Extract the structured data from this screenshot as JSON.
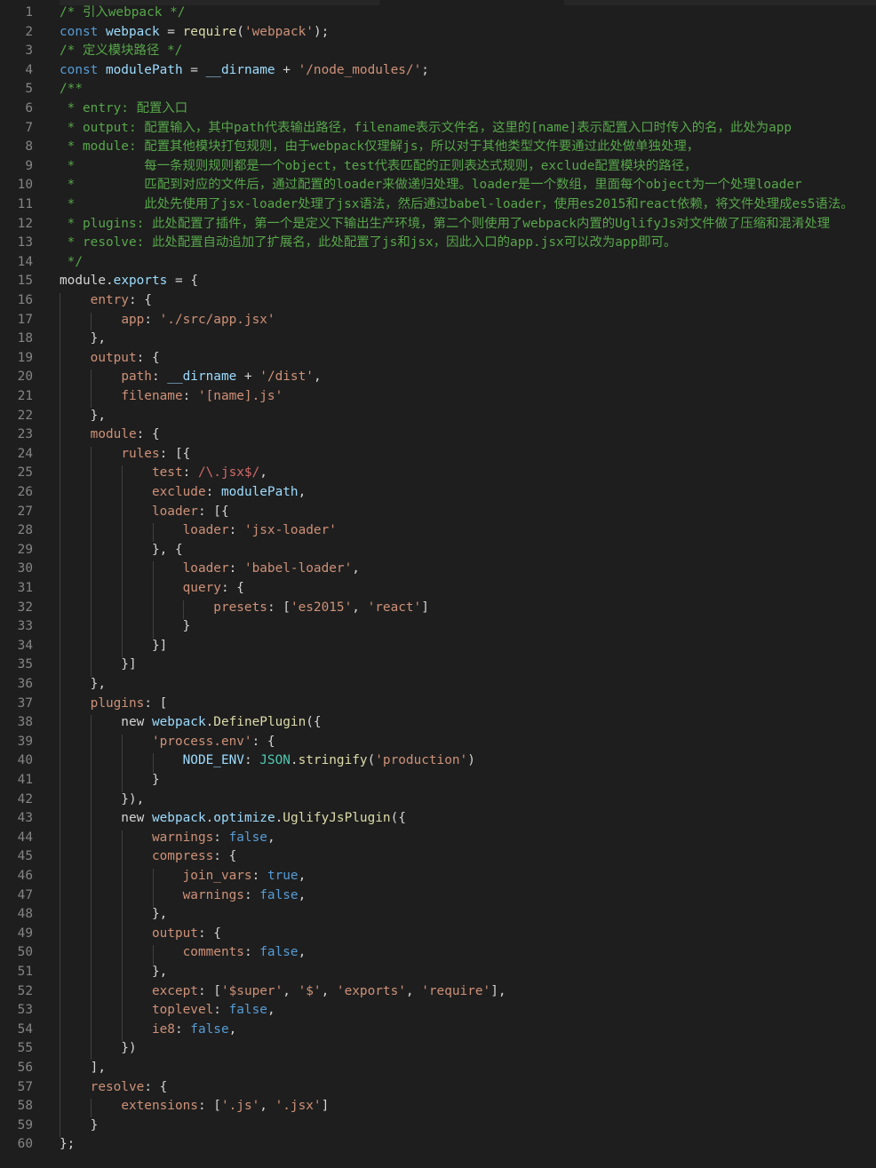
{
  "editor": {
    "colors": {
      "background": "#1e1e1e",
      "line_number": "#858585",
      "comment": "#57a64a",
      "keyword": "#569cd6",
      "variable": "#9cdcfe",
      "function": "#dcdcaa",
      "string": "#ce9178",
      "regex": "#d16969",
      "type": "#4ec9b0",
      "text": "#d4d4d4"
    },
    "lines": [
      {
        "n": "1",
        "tokens": [
          [
            "c",
            "/* 引入webpack */"
          ]
        ]
      },
      {
        "n": "2",
        "tokens": [
          [
            "k",
            "const "
          ],
          [
            "v",
            "webpack"
          ],
          [
            "o",
            " = "
          ],
          [
            "f",
            "require"
          ],
          [
            "p",
            "("
          ],
          [
            "s",
            "'webpack'"
          ],
          [
            "p",
            ");"
          ]
        ]
      },
      {
        "n": "3",
        "tokens": [
          [
            "c",
            "/* 定义模块路径 */"
          ]
        ]
      },
      {
        "n": "4",
        "tokens": [
          [
            "k",
            "const "
          ],
          [
            "v",
            "modulePath"
          ],
          [
            "o",
            " = "
          ],
          [
            "v",
            "__dirname"
          ],
          [
            "o",
            " + "
          ],
          [
            "s",
            "'/node_modules/'"
          ],
          [
            "p",
            ";"
          ]
        ]
      },
      {
        "n": "5",
        "tokens": [
          [
            "c",
            "/**"
          ]
        ]
      },
      {
        "n": "6",
        "tokens": [
          [
            "c",
            " * entry: 配置入口"
          ]
        ]
      },
      {
        "n": "7",
        "tokens": [
          [
            "c",
            " * output: 配置输入，其中path代表输出路径，filename表示文件名，这里的[name]表示配置入口时传入的名，此处为app"
          ]
        ]
      },
      {
        "n": "8",
        "tokens": [
          [
            "c",
            " * module: 配置其他模块打包规则，由于webpack仅理解js，所以对于其他类型文件要通过此处做单独处理，"
          ]
        ]
      },
      {
        "n": "9",
        "tokens": [
          [
            "c",
            " *         每一条规则规则都是一个object，test代表匹配的正则表达式规则，exclude配置模块的路径，"
          ]
        ]
      },
      {
        "n": "10",
        "tokens": [
          [
            "c",
            " *         匹配到对应的文件后，通过配置的loader来做递归处理。loader是一个数组，里面每个object为一个处理loader"
          ]
        ]
      },
      {
        "n": "11",
        "tokens": [
          [
            "c",
            " *         此处先使用了jsx-loader处理了jsx语法，然后通过babel-loader，使用es2015和react依赖，将文件处理成es5语法。"
          ]
        ]
      },
      {
        "n": "12",
        "tokens": [
          [
            "c",
            " * plugins: 此处配置了插件，第一个是定义下输出生产环境，第二个则使用了webpack内置的UglifyJs对文件做了压缩和混淆处理"
          ]
        ]
      },
      {
        "n": "13",
        "tokens": [
          [
            "c",
            " * resolve: 此处配置自动追加了扩展名，此处配置了js和jsx，因此入口的app.jsx可以改为app即可。"
          ]
        ]
      },
      {
        "n": "14",
        "tokens": [
          [
            "c",
            " */"
          ]
        ]
      },
      {
        "n": "15",
        "tokens": [
          [
            "p",
            "module."
          ],
          [
            "v",
            "exports"
          ],
          [
            "o",
            " = "
          ],
          [
            "p",
            "{"
          ]
        ]
      },
      {
        "n": "16",
        "tokens": [
          [
            "p",
            "    "
          ],
          [
            "s",
            "entry"
          ],
          [
            "p",
            ": {"
          ]
        ]
      },
      {
        "n": "17",
        "tokens": [
          [
            "p",
            "        "
          ],
          [
            "s",
            "app"
          ],
          [
            "p",
            ": "
          ],
          [
            "s",
            "'./src/app.jsx'"
          ]
        ]
      },
      {
        "n": "18",
        "tokens": [
          [
            "p",
            "    },"
          ]
        ]
      },
      {
        "n": "19",
        "tokens": [
          [
            "p",
            "    "
          ],
          [
            "s",
            "output"
          ],
          [
            "p",
            ": {"
          ]
        ]
      },
      {
        "n": "20",
        "tokens": [
          [
            "p",
            "        "
          ],
          [
            "s",
            "path"
          ],
          [
            "p",
            ": "
          ],
          [
            "v",
            "__dirname"
          ],
          [
            "o",
            " + "
          ],
          [
            "s",
            "'/dist'"
          ],
          [
            "p",
            ","
          ]
        ]
      },
      {
        "n": "21",
        "tokens": [
          [
            "p",
            "        "
          ],
          [
            "s",
            "filename"
          ],
          [
            "p",
            ": "
          ],
          [
            "s",
            "'[name].js'"
          ]
        ]
      },
      {
        "n": "22",
        "tokens": [
          [
            "p",
            "    },"
          ]
        ]
      },
      {
        "n": "23",
        "tokens": [
          [
            "p",
            "    "
          ],
          [
            "s",
            "module"
          ],
          [
            "p",
            ": {"
          ]
        ]
      },
      {
        "n": "24",
        "tokens": [
          [
            "p",
            "        "
          ],
          [
            "s",
            "rules"
          ],
          [
            "p",
            ": [{"
          ]
        ]
      },
      {
        "n": "25",
        "tokens": [
          [
            "p",
            "            "
          ],
          [
            "s",
            "test"
          ],
          [
            "p",
            ": "
          ],
          [
            "r",
            "/\\.jsx$/"
          ],
          [
            "p",
            ","
          ]
        ]
      },
      {
        "n": "26",
        "tokens": [
          [
            "p",
            "            "
          ],
          [
            "s",
            "exclude"
          ],
          [
            "p",
            ": "
          ],
          [
            "v",
            "modulePath"
          ],
          [
            "p",
            ","
          ]
        ]
      },
      {
        "n": "27",
        "tokens": [
          [
            "p",
            "            "
          ],
          [
            "s",
            "loader"
          ],
          [
            "p",
            ": [{"
          ]
        ]
      },
      {
        "n": "28",
        "tokens": [
          [
            "p",
            "                "
          ],
          [
            "s",
            "loader"
          ],
          [
            "p",
            ": "
          ],
          [
            "s",
            "'jsx-loader'"
          ]
        ]
      },
      {
        "n": "29",
        "tokens": [
          [
            "p",
            "            }, {"
          ]
        ]
      },
      {
        "n": "30",
        "tokens": [
          [
            "p",
            "                "
          ],
          [
            "s",
            "loader"
          ],
          [
            "p",
            ": "
          ],
          [
            "s",
            "'babel-loader'"
          ],
          [
            "p",
            ","
          ]
        ]
      },
      {
        "n": "31",
        "tokens": [
          [
            "p",
            "                "
          ],
          [
            "s",
            "query"
          ],
          [
            "p",
            ": {"
          ]
        ]
      },
      {
        "n": "32",
        "tokens": [
          [
            "p",
            "                    "
          ],
          [
            "s",
            "presets"
          ],
          [
            "p",
            ": ["
          ],
          [
            "s",
            "'es2015'"
          ],
          [
            "p",
            ", "
          ],
          [
            "s",
            "'react'"
          ],
          [
            "p",
            "]"
          ]
        ]
      },
      {
        "n": "33",
        "tokens": [
          [
            "p",
            "                }"
          ]
        ]
      },
      {
        "n": "34",
        "tokens": [
          [
            "p",
            "            }]"
          ]
        ]
      },
      {
        "n": "35",
        "tokens": [
          [
            "p",
            "        }]"
          ]
        ]
      },
      {
        "n": "36",
        "tokens": [
          [
            "p",
            "    },"
          ]
        ]
      },
      {
        "n": "37",
        "tokens": [
          [
            "p",
            "    "
          ],
          [
            "s",
            "plugins"
          ],
          [
            "p",
            ": ["
          ]
        ]
      },
      {
        "n": "38",
        "tokens": [
          [
            "p",
            "        new "
          ],
          [
            "v",
            "webpack"
          ],
          [
            "p",
            "."
          ],
          [
            "f",
            "DefinePlugin"
          ],
          [
            "p",
            "({"
          ]
        ]
      },
      {
        "n": "39",
        "tokens": [
          [
            "p",
            "            "
          ],
          [
            "s",
            "'process.env'"
          ],
          [
            "p",
            ": {"
          ]
        ]
      },
      {
        "n": "40",
        "tokens": [
          [
            "p",
            "                "
          ],
          [
            "v",
            "NODE_ENV"
          ],
          [
            "p",
            ": "
          ],
          [
            "ty",
            "JSON"
          ],
          [
            "p",
            "."
          ],
          [
            "f",
            "stringify"
          ],
          [
            "p",
            "("
          ],
          [
            "s",
            "'production'"
          ],
          [
            "p",
            ")"
          ]
        ]
      },
      {
        "n": "41",
        "tokens": [
          [
            "p",
            "            }"
          ]
        ]
      },
      {
        "n": "42",
        "tokens": [
          [
            "p",
            "        }),"
          ]
        ]
      },
      {
        "n": "43",
        "tokens": [
          [
            "p",
            "        new "
          ],
          [
            "v",
            "webpack"
          ],
          [
            "p",
            "."
          ],
          [
            "v",
            "optimize"
          ],
          [
            "p",
            "."
          ],
          [
            "f",
            "UglifyJsPlugin"
          ],
          [
            "p",
            "({"
          ]
        ]
      },
      {
        "n": "44",
        "tokens": [
          [
            "p",
            "            "
          ],
          [
            "s",
            "warnings"
          ],
          [
            "p",
            ": "
          ],
          [
            "b",
            "false"
          ],
          [
            "p",
            ","
          ]
        ]
      },
      {
        "n": "45",
        "tokens": [
          [
            "p",
            "            "
          ],
          [
            "s",
            "compress"
          ],
          [
            "p",
            ": {"
          ]
        ]
      },
      {
        "n": "46",
        "tokens": [
          [
            "p",
            "                "
          ],
          [
            "s",
            "join_vars"
          ],
          [
            "p",
            ": "
          ],
          [
            "b",
            "true"
          ],
          [
            "p",
            ","
          ]
        ]
      },
      {
        "n": "47",
        "tokens": [
          [
            "p",
            "                "
          ],
          [
            "s",
            "warnings"
          ],
          [
            "p",
            ": "
          ],
          [
            "b",
            "false"
          ],
          [
            "p",
            ","
          ]
        ]
      },
      {
        "n": "48",
        "tokens": [
          [
            "p",
            "            },"
          ]
        ]
      },
      {
        "n": "49",
        "tokens": [
          [
            "p",
            "            "
          ],
          [
            "s",
            "output"
          ],
          [
            "p",
            ": {"
          ]
        ]
      },
      {
        "n": "50",
        "tokens": [
          [
            "p",
            "                "
          ],
          [
            "s",
            "comments"
          ],
          [
            "p",
            ": "
          ],
          [
            "b",
            "false"
          ],
          [
            "p",
            ","
          ]
        ]
      },
      {
        "n": "51",
        "tokens": [
          [
            "p",
            "            },"
          ]
        ]
      },
      {
        "n": "52",
        "tokens": [
          [
            "p",
            "            "
          ],
          [
            "s",
            "except"
          ],
          [
            "p",
            ": ["
          ],
          [
            "s",
            "'$super'"
          ],
          [
            "p",
            ", "
          ],
          [
            "s",
            "'$'"
          ],
          [
            "p",
            ", "
          ],
          [
            "s",
            "'exports'"
          ],
          [
            "p",
            ", "
          ],
          [
            "s",
            "'require'"
          ],
          [
            "p",
            "],"
          ]
        ]
      },
      {
        "n": "53",
        "tokens": [
          [
            "p",
            "            "
          ],
          [
            "s",
            "toplevel"
          ],
          [
            "p",
            ": "
          ],
          [
            "b",
            "false"
          ],
          [
            "p",
            ","
          ]
        ]
      },
      {
        "n": "54",
        "tokens": [
          [
            "p",
            "            "
          ],
          [
            "s",
            "ie8"
          ],
          [
            "p",
            ": "
          ],
          [
            "b",
            "false"
          ],
          [
            "p",
            ","
          ]
        ]
      },
      {
        "n": "55",
        "tokens": [
          [
            "p",
            "        })"
          ]
        ]
      },
      {
        "n": "56",
        "tokens": [
          [
            "p",
            "    ],"
          ]
        ]
      },
      {
        "n": "57",
        "tokens": [
          [
            "p",
            "    "
          ],
          [
            "s",
            "resolve"
          ],
          [
            "p",
            ": {"
          ]
        ]
      },
      {
        "n": "58",
        "tokens": [
          [
            "p",
            "        "
          ],
          [
            "s",
            "extensions"
          ],
          [
            "p",
            ": ["
          ],
          [
            "s",
            "'.js'"
          ],
          [
            "p",
            ", "
          ],
          [
            "s",
            "'.jsx'"
          ],
          [
            "p",
            "]"
          ]
        ]
      },
      {
        "n": "59",
        "tokens": [
          [
            "p",
            "    }"
          ]
        ]
      },
      {
        "n": "60",
        "tokens": [
          [
            "p",
            "};"
          ]
        ]
      }
    ]
  }
}
